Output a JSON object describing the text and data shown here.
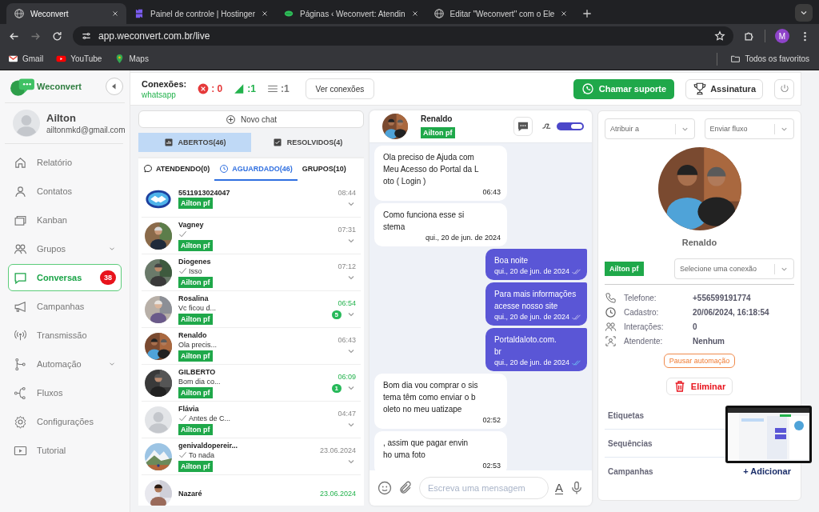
{
  "browser": {
    "tabs": [
      {
        "title": "Weconvert",
        "kind": "globe",
        "selected": true
      },
      {
        "title": "Painel de controle | Hostinger",
        "kind": "hostinger",
        "selected": false
      },
      {
        "title": "Páginas ‹ Weconvert: Atendin",
        "kind": "leaf",
        "selected": false
      },
      {
        "title": "Editar \"Weconvert\" com o Ele",
        "kind": "globe",
        "selected": false
      }
    ],
    "nav_buttons": [
      {
        "kind": "back",
        "disabled": false
      },
      {
        "kind": "forward",
        "disabled": true
      },
      {
        "kind": "reload",
        "disabled": false
      }
    ],
    "url": "app.weconvert.com.br/live",
    "profile": "M",
    "bookmarks": [
      {
        "label": "Gmail",
        "kind": "gmail"
      },
      {
        "label": "YouTube",
        "kind": "youtube"
      },
      {
        "label": "Maps",
        "kind": "maps"
      }
    ],
    "all_bookmarks": "Todos os favoritos"
  },
  "sidebar": {
    "logo": "Weconvert",
    "user": {
      "name": "Ailton",
      "email": "ailtonmkd@gmail.com"
    },
    "nav": [
      {
        "label": "Relatório",
        "kind": "home",
        "selected": false,
        "expandable": false
      },
      {
        "label": "Contatos",
        "kind": "user",
        "selected": false,
        "expandable": false
      },
      {
        "label": "Kanban",
        "kind": "kanban",
        "selected": false,
        "expandable": false
      },
      {
        "label": "Grupos",
        "kind": "users",
        "selected": false,
        "expandable": true
      },
      {
        "label": "Conversas",
        "kind": "chat",
        "selected": true,
        "expandable": false,
        "badge": "38"
      },
      {
        "label": "Campanhas",
        "kind": "megaphone",
        "selected": false,
        "expandable": false
      },
      {
        "label": "Transmissão",
        "kind": "broadcast",
        "selected": false,
        "expandable": false
      },
      {
        "label": "Automação",
        "kind": "branch",
        "selected": false,
        "expandable": true
      },
      {
        "label": "Fluxos",
        "kind": "nodes",
        "selected": false,
        "expandable": false
      },
      {
        "label": "Configurações",
        "kind": "gear",
        "selected": false,
        "expandable": false
      },
      {
        "label": "Tutorial",
        "kind": "play",
        "selected": false,
        "expandable": false
      }
    ]
  },
  "topbar": {
    "title": "Conexões:",
    "subtitle": "whatsapp",
    "counts": [
      {
        "kind": "error",
        "value": ": 0"
      },
      {
        "kind": "signal",
        "value": ":1"
      },
      {
        "kind": "queue",
        "value": ":1"
      }
    ],
    "view_button": "Ver conexões",
    "support_button": "Chamar suporte",
    "subscription_button": "Assinatura"
  },
  "chat_list": {
    "new_chat": "Novo chat",
    "status_tabs": [
      {
        "label": "ABERTOS(46)",
        "kind": "chart",
        "selected": true
      },
      {
        "label": "RESOLVIDOS(4)",
        "kind": "checkbox",
        "selected": false
      }
    ],
    "queue_tabs": [
      {
        "label": "ATENDENDO(0)",
        "kind": "bubble",
        "selected": false
      },
      {
        "label": "AGUARDADO(46)",
        "kind": "clock",
        "selected": true
      },
      {
        "label": "GRUPOS(10)",
        "kind": "plain",
        "selected": false
      }
    ],
    "chats": [
      {
        "name": "5511913024047",
        "kind": "logo",
        "sent": false,
        "tag": "Ailton pf",
        "time": "08:44",
        "highlight": false
      },
      {
        "name": "Vagney",
        "kind": "picture",
        "sent": true,
        "tag": "Ailton pf",
        "time": "07:31",
        "highlight": false
      },
      {
        "name": "Diogenes",
        "kind": "picture",
        "sent": true,
        "preview": "Isso",
        "tag": "Ailton pf",
        "time": "07:12",
        "highlight": false
      },
      {
        "name": "Rosalina",
        "kind": "picture",
        "sent": false,
        "preview": "Vc ficou d...",
        "tag": "Ailton pf",
        "time": "06:54",
        "highlight": true,
        "unread": "5"
      },
      {
        "name": "Renaldo",
        "kind": "picture",
        "sent": false,
        "preview": "Ola precis...",
        "tag": "Ailton pf",
        "time": "06:43",
        "highlight": false
      },
      {
        "name": "GILBERTO",
        "kind": "picture",
        "sent": false,
        "preview": "Bom dia co...",
        "tag": "Ailton pf",
        "time": "06:09",
        "highlight": true,
        "unread": "1"
      },
      {
        "name": "Flávia",
        "kind": "placeholder",
        "sent": true,
        "preview": "Antes de C...",
        "tag": "Ailton pf",
        "time": "04:47",
        "highlight": false
      },
      {
        "name": "genivaldopereir...",
        "kind": "picture",
        "sent": true,
        "preview": "To nada",
        "tag": "Ailton pf",
        "time": "23.06.2024",
        "highlight": false
      },
      {
        "name": "Nazaré",
        "kind": "picture",
        "time": "23.06.2024",
        "highlight": true
      }
    ]
  },
  "conversation": {
    "name": "Renaldo",
    "tag": "Ailton pf",
    "toggle_on": true,
    "messages": [
      {
        "text": "Ola preciso de Ajuda com\nMeu Acesso do Portal da L\noto ( Login )",
        "time": "06:43",
        "outgoing": false
      },
      {
        "text": "Como funciona esse si\nstema",
        "time": "qui., 20 de jun. de 2024",
        "outgoing": false
      },
      {
        "text": "Boa noite",
        "time": "qui., 20 de jun. de 2024",
        "outgoing": true,
        "read": false
      },
      {
        "text": "Para mais informações\nacesse nosso site",
        "time": "qui., 20 de jun. de 2024",
        "outgoing": true,
        "read": false
      },
      {
        "text": "Portaldaloto.com.\nbr",
        "time": "qui., 20 de jun. de 2024",
        "outgoing": true,
        "read": true
      },
      {
        "text": "Bom dia vou comprar o sis\ntema têm como enviar o b\noleto no meu uatizape",
        "time": "02:52",
        "outgoing": false
      },
      {
        "text": ", assim que pagar envin\nho uma foto",
        "time": "02:53",
        "outgoing": false
      }
    ],
    "placeholder": "Escreva uma mensagem",
    "format_label": "A"
  },
  "contact": {
    "assign_placeholder": "Atribuir a",
    "flow_placeholder": "Enviar fluxo",
    "name": "Renaldo",
    "tag": "Ailton pf",
    "connection_placeholder": "Selecione uma conexão",
    "details": [
      {
        "kind": "phone",
        "label": "Telefone:",
        "value": "+556599191774"
      },
      {
        "kind": "clock",
        "label": "Cadastro:",
        "value": "20/06/2024, 16:18:54"
      },
      {
        "kind": "users",
        "label": "Interações:",
        "value": "0"
      },
      {
        "kind": "userscan",
        "label": "Atendente:",
        "value": "Nenhum"
      }
    ],
    "pause_button": "Pausar automação",
    "delete_button": "Eliminar",
    "sections": [
      {
        "label": "Etiquetas"
      },
      {
        "label": "Sequências"
      },
      {
        "label": "Campanhas",
        "action": "+ Adicionar"
      }
    ]
  }
}
